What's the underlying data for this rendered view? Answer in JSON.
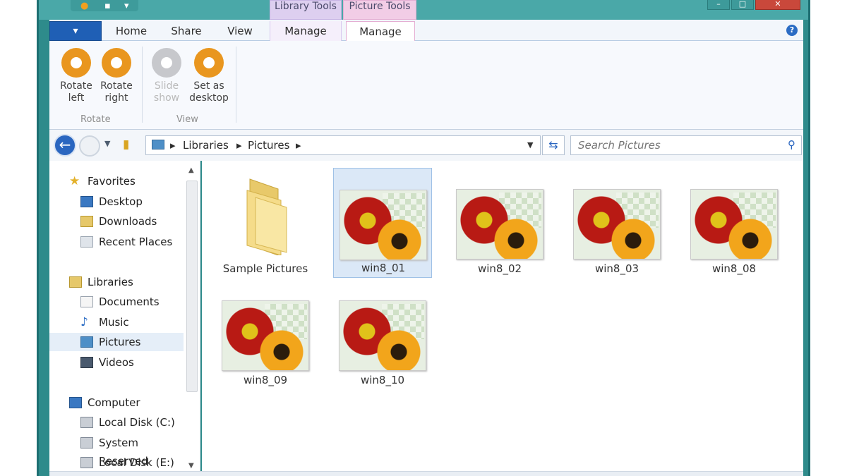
{
  "window": {
    "context_tabs": {
      "library_tools": "Library Tools",
      "picture_tools": "Picture Tools"
    },
    "controls": {
      "minimize": "–",
      "maximize": "□",
      "close": "✕"
    }
  },
  "ribbon": {
    "file_button": "▾",
    "tabs": [
      "Home",
      "Share",
      "View",
      "Manage",
      "Manage"
    ],
    "help": "?",
    "buttons": {
      "rotate_left": "Rotate left",
      "rotate_right": "Rotate right",
      "slide_show": "Slide show",
      "set_desktop": "Set as desktop"
    },
    "groups": {
      "rotate": "Rotate",
      "view": "View"
    }
  },
  "address": {
    "crumbs": [
      "Libraries",
      "Pictures"
    ],
    "search_placeholder": "Search Pictures"
  },
  "nav": {
    "favorites": "Favorites",
    "desktop": "Desktop",
    "downloads": "Downloads",
    "recent": "Recent Places",
    "libraries": "Libraries",
    "documents": "Documents",
    "music": "Music",
    "pictures": "Pictures",
    "videos": "Videos",
    "computer": "Computer",
    "local_c": "Local Disk (C:)",
    "system_reserved": "System Reserved",
    "local_e": "Local Disk (E:)"
  },
  "items": [
    {
      "name": "Sample Pictures",
      "type": "folder"
    },
    {
      "name": "win8_01",
      "type": "image",
      "selected": true
    },
    {
      "name": "win8_02",
      "type": "image"
    },
    {
      "name": "win8_03",
      "type": "image"
    },
    {
      "name": "win8_08",
      "type": "image"
    },
    {
      "name": "win8_09",
      "type": "image"
    },
    {
      "name": "win8_10",
      "type": "image"
    }
  ],
  "colors": {
    "accent": "#1f5fb5",
    "frame": "#2e8b8b",
    "rotate_icon": "#e9961f",
    "selection": "#dbe8f7"
  }
}
